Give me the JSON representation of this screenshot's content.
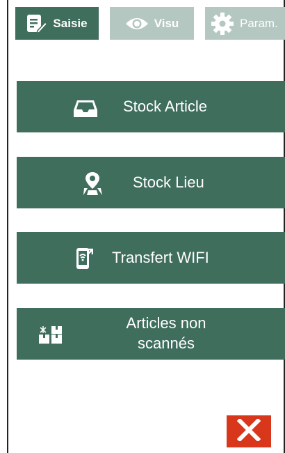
{
  "tabs": [
    {
      "label": "Saisie",
      "icon": "edit-document-icon",
      "state": "active"
    },
    {
      "label": "Visu",
      "icon": "eye-icon",
      "state": "inactive"
    },
    {
      "label": "Param.",
      "icon": "gear-icon",
      "state": "inactive"
    }
  ],
  "menu": [
    {
      "label": "Stock Article",
      "icon": "inbox-tray-icon"
    },
    {
      "label": "Stock Lieu",
      "icon": "map-pin-icon"
    },
    {
      "label": "Transfert WIFI",
      "icon": "phone-wifi-icon"
    },
    {
      "label_line1": "Articles non",
      "label_line2": "scannés",
      "icon": "boxes-icon"
    }
  ],
  "close": {
    "icon": "close-icon"
  },
  "colors": {
    "primary": "#3f6e5d",
    "tab_inactive": "#b4c7c0",
    "close": "#d9371c"
  }
}
